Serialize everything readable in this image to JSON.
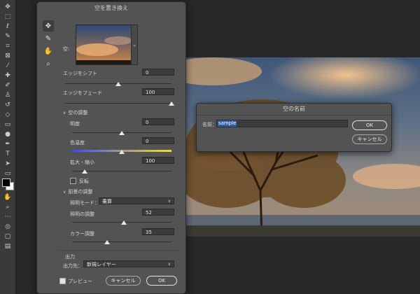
{
  "dialog": {
    "title": "空を置き換え",
    "sky_label": "空:",
    "sky_dropdown_arrow": "⌄",
    "shift_edge": {
      "label": "エッジをシフト",
      "value": "0",
      "slider_pct": 50
    },
    "fade_edge": {
      "label": "エッジをフェード",
      "value": "100",
      "slider_pct": 100
    },
    "sky_adjust": {
      "header": "空の調整",
      "brightness": {
        "label": "明度",
        "value": "0",
        "slider_pct": 50
      },
      "temperature": {
        "label": "色温度",
        "value": "0",
        "slider_pct": 50
      },
      "scale": {
        "label": "拡大・縮小",
        "value": "100",
        "slider_pct": 13
      },
      "flip": {
        "label": "反転",
        "checked": false
      }
    },
    "fg_adjust": {
      "header": "前景の調整",
      "lighting_mode": {
        "label": "照明モード：",
        "value": "乗算"
      },
      "lighting_adjust": {
        "label": "照明の調整",
        "value": "52",
        "slider_pct": 52
      },
      "color_adjust": {
        "label": "カラー調整",
        "value": "35",
        "slider_pct": 35
      }
    },
    "output": {
      "header": "出力",
      "output_to_label": "出力先：",
      "output_to_value": "新規レイヤー"
    },
    "preview_label": "プレビュー",
    "preview_checked": true,
    "cancel_label": "キャンセル",
    "ok_label": "OK"
  },
  "name_dialog": {
    "title": "空の名前",
    "name_label": "名前：",
    "name_value": "sample",
    "ok_label": "OK",
    "cancel_label": "キャンセル"
  },
  "toolbar": {
    "tools": [
      "move-icon",
      "marquee-icon",
      "lasso-icon",
      "quick-select-icon",
      "crop-icon",
      "frame-icon",
      "eyedropper-icon",
      "healing-icon",
      "brush-icon",
      "stamp-icon",
      "history-brush-icon",
      "eraser-icon",
      "gradient-icon",
      "blur-icon",
      "dodge-icon",
      "pen-icon",
      "type-icon",
      "path-select-icon",
      "rectangle-icon",
      "hand-icon",
      "zoom-icon",
      "more-icon",
      "screen-mode-icon",
      "quick-mask-icon"
    ]
  },
  "colors": {
    "dialog_bg": "#535353",
    "app_bg": "#282828",
    "selection": "#2f5ea8"
  }
}
